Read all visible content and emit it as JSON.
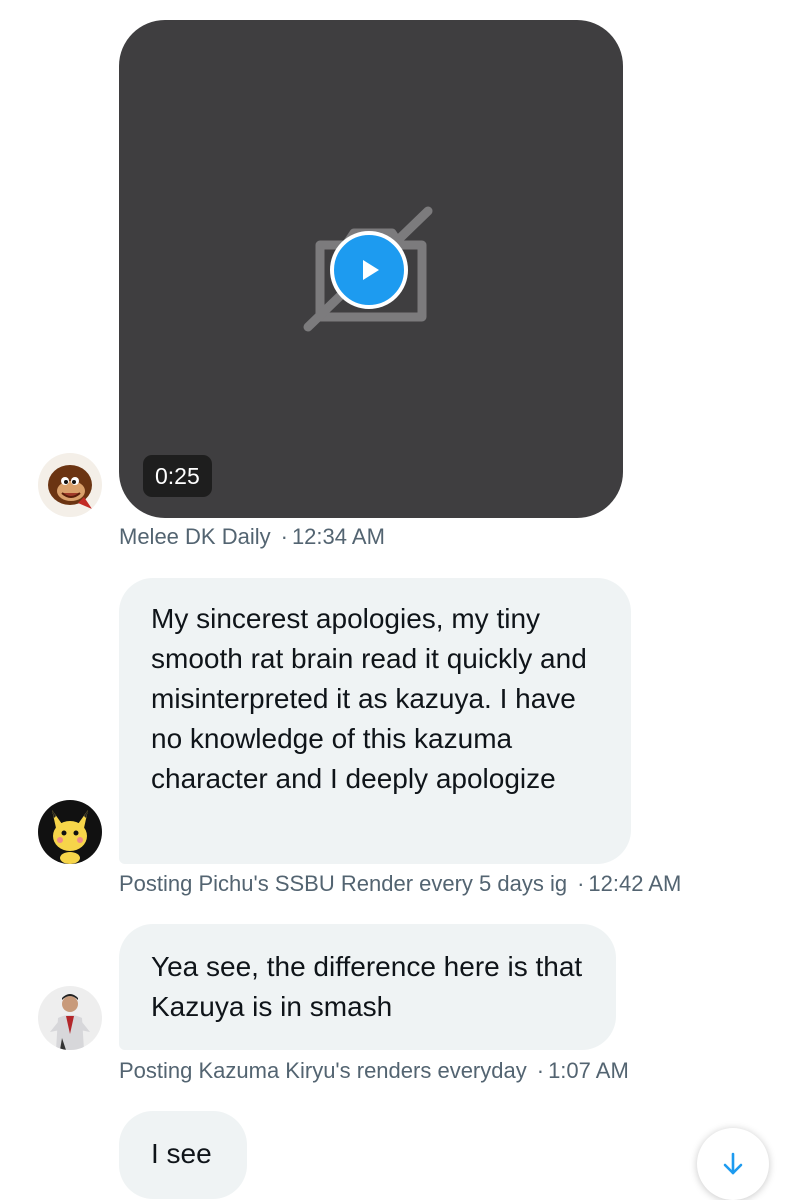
{
  "video": {
    "duration": "0:25",
    "sender": "Melee DK Daily",
    "time": "12:34 AM"
  },
  "messages": [
    {
      "sender": "Posting Pichu's SSBU Render every 5 days ig",
      "time": "12:42 AM",
      "text": "My sincerest apologies, my tiny smooth rat brain read it quickly and misinterpreted it as kazuya. I have no knowledge of this kazuma character and I deeply apologize"
    },
    {
      "sender": "Posting Kazuma Kiryu's renders everyday",
      "time": "1:07 AM",
      "text": "Yea see, the difference here is that Kazuya is in smash"
    },
    {
      "text": "I see"
    }
  ],
  "separator": "·",
  "icons": {
    "play": "play-icon",
    "placeholder": "video-unavailable-icon",
    "scroll": "arrow-down-icon"
  },
  "colors": {
    "accent": "#1d9bf0",
    "bubble": "#eff3f4",
    "meta_text": "#536471",
    "video_bg": "#3f3e40"
  }
}
